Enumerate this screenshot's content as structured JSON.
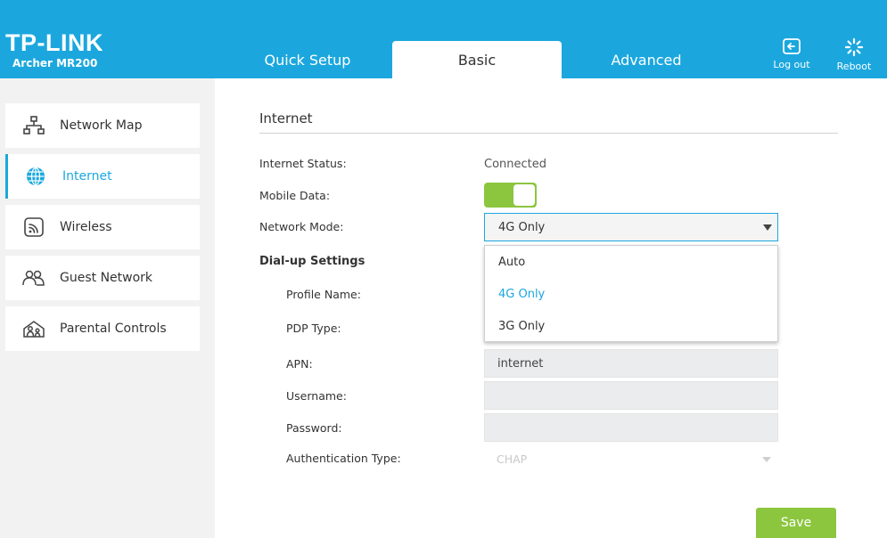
{
  "header": {
    "brand": "TP-LINK",
    "model": "Archer MR200",
    "tabs": [
      {
        "label": "Quick Setup"
      },
      {
        "label": "Basic",
        "active": true
      },
      {
        "label": "Advanced"
      }
    ],
    "logout_label": "Log out",
    "reboot_label": "Reboot",
    "color": "#1ba7de"
  },
  "sidebar": {
    "items": [
      {
        "label": "Network Map",
        "icon": "network-map-icon"
      },
      {
        "label": "Internet",
        "icon": "globe-icon",
        "active": true
      },
      {
        "label": "Wireless",
        "icon": "wireless-icon"
      },
      {
        "label": "Guest Network",
        "icon": "guest-network-icon"
      },
      {
        "label": "Parental Controls",
        "icon": "parental-controls-icon"
      }
    ]
  },
  "main": {
    "section_title": "Internet",
    "internet_status_label": "Internet Status:",
    "internet_status_value": "Connected",
    "mobile_data_label": "Mobile Data:",
    "mobile_data_on": true,
    "network_mode_label": "Network Mode:",
    "network_mode_value": "4G Only",
    "network_mode_options": [
      "Auto",
      "4G Only",
      "3G Only"
    ],
    "dialup_heading": "Dial-up Settings",
    "profile_name_label": "Profile Name:",
    "pdp_type_label": "PDP Type:",
    "apn_label": "APN:",
    "apn_value": "internet",
    "username_label": "Username:",
    "username_value": "",
    "password_label": "Password:",
    "password_value": "",
    "auth_type_label": "Authentication Type:",
    "auth_type_value": "CHAP",
    "save_label": "Save"
  },
  "colors": {
    "accent": "#1ba7de",
    "toggle_on": "#8cc63f",
    "save_button": "#8cc63f"
  }
}
